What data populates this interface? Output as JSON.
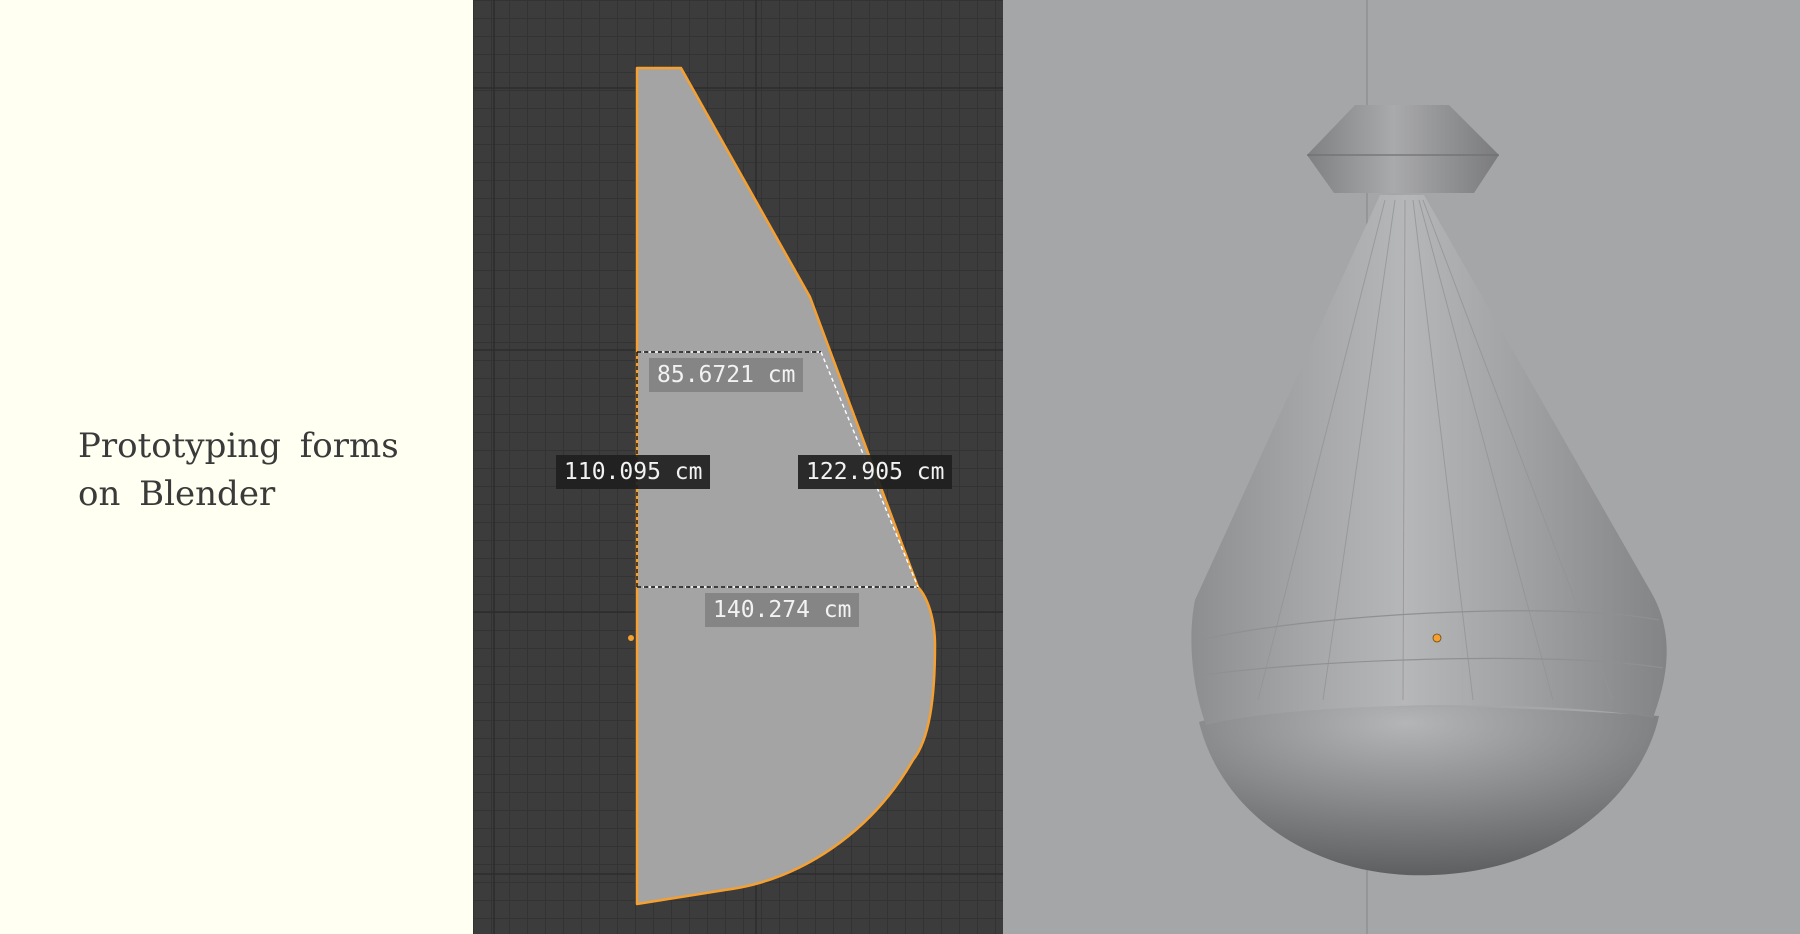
{
  "caption": {
    "line1": "Prototyping  forms",
    "line2": "on  Blender"
  },
  "profile_view": {
    "measurements": {
      "top_width": "85.6721 cm",
      "left_height": "110.095 cm",
      "slant_length": "122.905 cm",
      "bottom_width": "140.274 cm"
    }
  },
  "colors": {
    "selection_outline": "#f5a030",
    "grid_background": "#3c3c3c",
    "mesh_fill": "#a4a4a4",
    "render_background": "#a5a6a8"
  }
}
